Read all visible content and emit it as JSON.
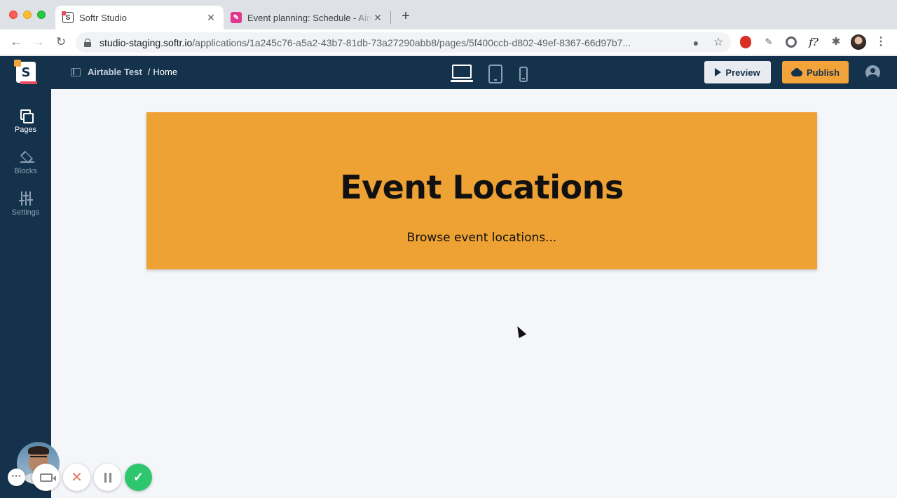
{
  "browser": {
    "tabs": [
      {
        "title": "Softr Studio",
        "active": true,
        "favicon": "softr-icon"
      },
      {
        "title": "Event planning: Schedule - Airtable",
        "active": false,
        "favicon": "airtable-icon"
      }
    ],
    "close_glyph": "✕",
    "new_tab_glyph": "+",
    "url_host": "studio-staging.softr.io",
    "url_path": "/applications/1a245c76-a5a2-43b7-81db-73a27290abb8/pages/5f400ccb-d802-49ef-8367-66d97b7...",
    "nav": {
      "back": "←",
      "forward": "→",
      "reload": "↻"
    },
    "omnibox_icons": {
      "mic": "🎙",
      "star": "☆"
    },
    "extensions": [
      "adblock-icon",
      "eyedropper-icon",
      "chrome-ext-icon",
      "formula-icon",
      "puzzle-icon",
      "profile-avatar"
    ],
    "formula_glyph": "f?",
    "puzzle_glyph": "✱",
    "eyedropper_glyph": "✎",
    "menu_glyph": "⋮"
  },
  "header": {
    "logo_letter": "S",
    "app_name": "Airtable Test",
    "separator": "/",
    "page_name": "Home",
    "devices": [
      "desktop",
      "tablet",
      "mobile"
    ],
    "active_device": "desktop",
    "preview_label": "Preview",
    "publish_label": "Publish"
  },
  "sidebar": {
    "items": [
      {
        "label": "Pages",
        "icon": "pages-icon",
        "active": true
      },
      {
        "label": "Blocks",
        "icon": "blocks-icon",
        "active": false
      },
      {
        "label": "Settings",
        "icon": "settings-icon",
        "active": false
      }
    ]
  },
  "hero": {
    "title": "Event Locations",
    "subtitle": "Browse event locations..."
  },
  "recorder": {
    "more_glyph": "···",
    "cancel_glyph": "✕",
    "done_glyph": "✓"
  },
  "colors": {
    "app_header": "#14324c",
    "hero_background": "#eea233",
    "publish_button": "#f2a33a",
    "canvas": "#f5f6fa"
  }
}
